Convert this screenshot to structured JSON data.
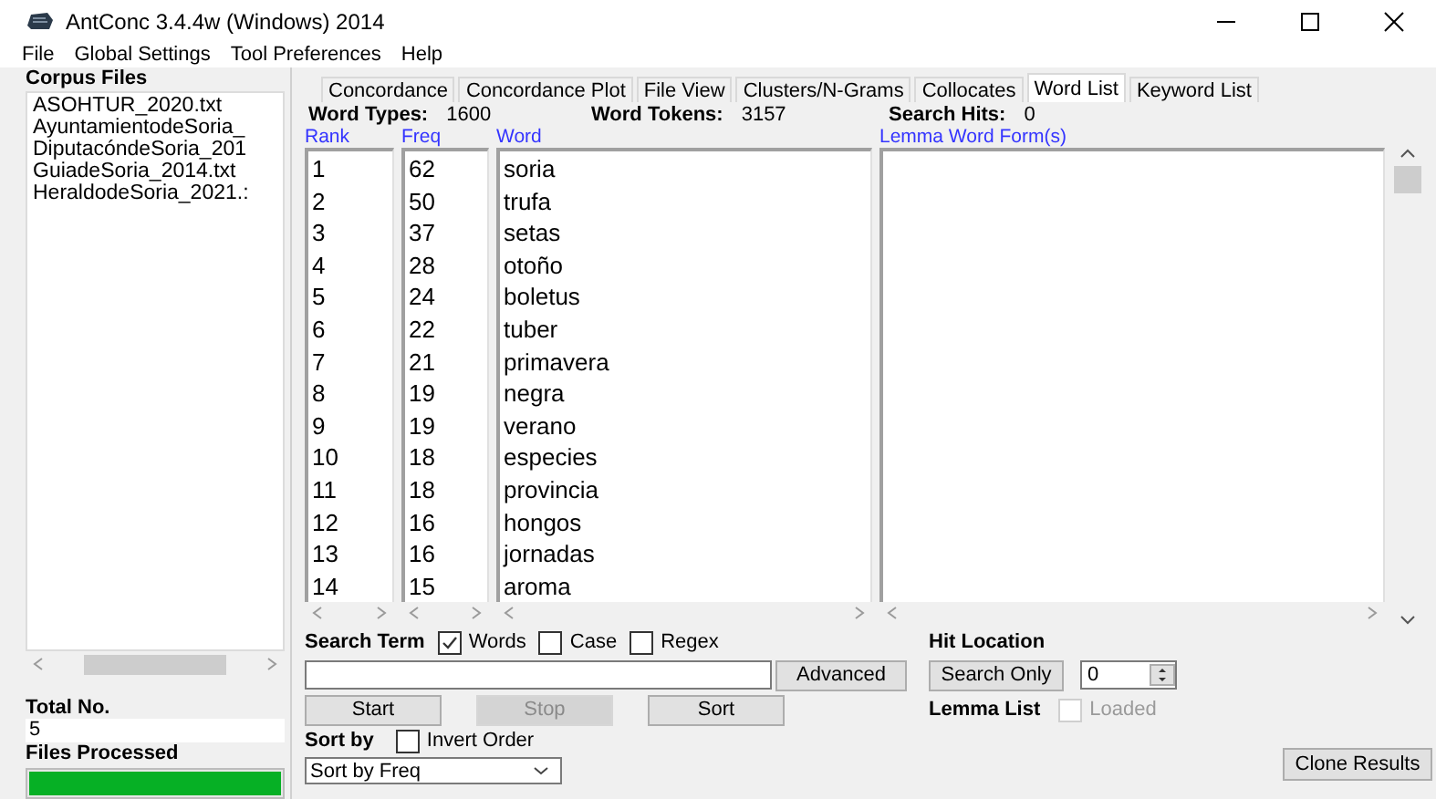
{
  "window": {
    "title": "AntConc 3.4.4w (Windows) 2014"
  },
  "menu": [
    {
      "label": "File"
    },
    {
      "label": "Global Settings"
    },
    {
      "label": "Tool Preferences"
    },
    {
      "label": "Help"
    }
  ],
  "corpus_files": {
    "label": "Corpus Files",
    "files": [
      "ASOHTUR_2020.txt",
      "AyuntamientodeSoria_",
      "DiputacóndeSoria_201",
      "GuiadeSoria_2014.txt",
      "HeraldodeSoria_2021.:"
    ]
  },
  "total_no": {
    "label": "Total No.",
    "value": "5"
  },
  "files_processed": {
    "label": "Files Processed",
    "level": 1
  },
  "tabs": [
    {
      "label": "Concordance",
      "selected": false
    },
    {
      "label": "Concordance Plot",
      "selected": false
    },
    {
      "label": "File View",
      "selected": false
    },
    {
      "label": "Clusters/N-Grams",
      "selected": false
    },
    {
      "label": "Collocates",
      "selected": false
    },
    {
      "label": "Word List",
      "selected": true
    },
    {
      "label": "Keyword List",
      "selected": false
    }
  ],
  "stats": [
    {
      "label": "Word Types:",
      "value": "1600"
    },
    {
      "label": "Word Tokens:",
      "value": "3157"
    },
    {
      "label": "Search Hits:",
      "value": "0"
    }
  ],
  "columns": [
    "Rank",
    "Freq",
    "Word"
  ],
  "lemma_column": "Lemma Word Form(s)",
  "rows": [
    {
      "rank": "1",
      "freq": "62",
      "word": "soria"
    },
    {
      "rank": "2",
      "freq": "50",
      "word": "trufa"
    },
    {
      "rank": "3",
      "freq": "37",
      "word": "setas"
    },
    {
      "rank": "4",
      "freq": "28",
      "word": "otoño"
    },
    {
      "rank": "5",
      "freq": "24",
      "word": "boletus"
    },
    {
      "rank": "6",
      "freq": "22",
      "word": "tuber"
    },
    {
      "rank": "7",
      "freq": "21",
      "word": "primavera"
    },
    {
      "rank": "8",
      "freq": "19",
      "word": "negra"
    },
    {
      "rank": "9",
      "freq": "19",
      "word": "verano"
    },
    {
      "rank": "10",
      "freq": "18",
      "word": "especies"
    },
    {
      "rank": "11",
      "freq": "18",
      "word": "provincia"
    },
    {
      "rank": "12",
      "freq": "16",
      "word": "hongos"
    },
    {
      "rank": "13",
      "freq": "16",
      "word": "jornadas"
    },
    {
      "rank": "14",
      "freq": "15",
      "word": "aroma"
    }
  ],
  "search": {
    "label": "Search Term",
    "options": [
      {
        "label": "Words",
        "checked": true
      },
      {
        "label": "Case",
        "checked": false
      },
      {
        "label": "Regex",
        "checked": false
      }
    ],
    "advanced_button": {
      "label": "Advanced",
      "disabled": false
    }
  },
  "actions": [
    {
      "label": "Start",
      "disabled": false
    },
    {
      "label": "Stop",
      "disabled": true
    },
    {
      "label": "Sort",
      "disabled": false
    }
  ],
  "sort": {
    "label": "Sort by",
    "invert": {
      "label": "Invert Order",
      "checked": false
    },
    "value": "Sort by Freq"
  },
  "hit_location": {
    "label": "Hit Location",
    "button": "Search Only",
    "value": "0"
  },
  "lemma_list": {
    "label": "Lemma List",
    "loaded": {
      "label": "Loaded",
      "checked": false,
      "disabled": true
    }
  },
  "clone_button": "Clone Results"
}
